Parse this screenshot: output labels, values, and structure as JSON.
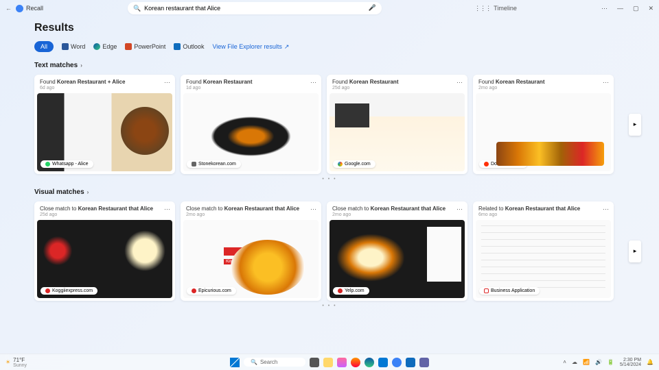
{
  "titlebar": {
    "app_name": "Recall",
    "search_value": "Korean restaurant that Alice",
    "timeline_label": "Timeline"
  },
  "page": {
    "title": "Results"
  },
  "filters": {
    "all": "All",
    "word": "Word",
    "edge": "Edge",
    "powerpoint": "PowerPoint",
    "outlook": "Outlook",
    "view_link": "View File Explorer results"
  },
  "sections": {
    "text": {
      "title": "Text matches"
    },
    "visual": {
      "title": "Visual matches"
    }
  },
  "text_cards": [
    {
      "prefix": "Found ",
      "bold": "Korean Restaurant + Alice",
      "time": "6d ago",
      "badge": "Whatsapp - Alice",
      "badge_color": "#25d366"
    },
    {
      "prefix": "Found ",
      "bold": "Korean Restaurant",
      "time": "1d ago",
      "badge": "Stonekorean.com",
      "badge_color": "#666"
    },
    {
      "prefix": "Found ",
      "bold": "Korean Restaurant",
      "time": "25d ago",
      "badge": "Google.com",
      "badge_color": "#ea4335"
    },
    {
      "prefix": "Found ",
      "bold": "Korean Restaurant",
      "time": "2mo ago",
      "badge": "Doordash.com",
      "badge_color": "#ff3008"
    }
  ],
  "visual_cards": [
    {
      "prefix": "Close match to ",
      "bold": "Korean Restaurant that Alice",
      "time": "25d ago",
      "badge": "Koggiiexpress.com",
      "badge_color": "#dc2626"
    },
    {
      "prefix": "Close match to ",
      "bold": "Korean Restaurant that Alice",
      "time": "2mo ago",
      "badge": "Epicurious.com",
      "badge_color": "#dc2626"
    },
    {
      "prefix": "Close match to ",
      "bold": "Korean Restaurant that Alice",
      "time": "2mo ago",
      "badge": "Yelp.com",
      "badge_color": "#d32323"
    },
    {
      "prefix": "Related to ",
      "bold": "Korean Restaurant that Alice",
      "time": "6mo ago",
      "badge": "Business Application",
      "badge_color": "#dc2626"
    }
  ],
  "epicurious_caption": "Kimchi Fried Rice",
  "taskbar": {
    "weather_temp": "71°F",
    "weather_cond": "Sunny",
    "search_placeholder": "Search",
    "time": "2:30 PM",
    "date": "5/14/2024"
  }
}
